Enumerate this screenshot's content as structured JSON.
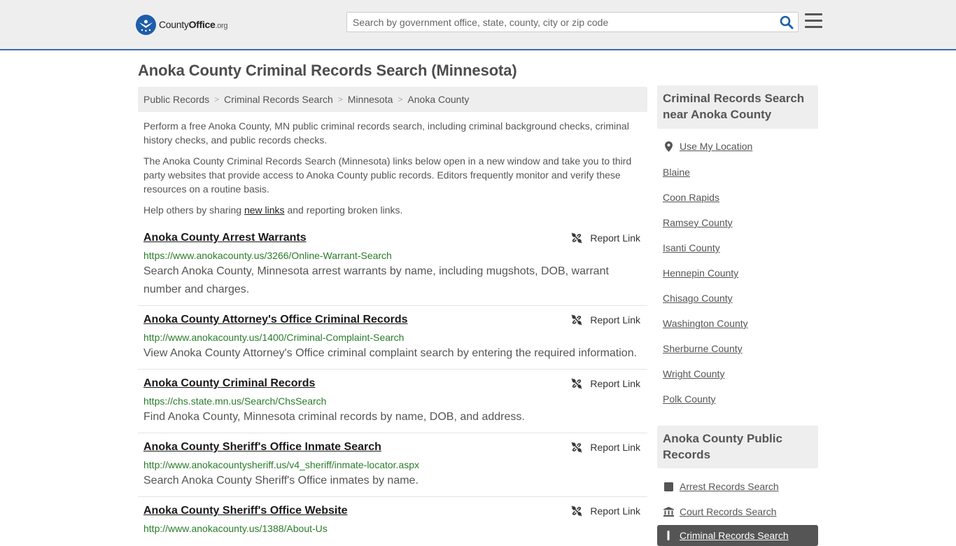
{
  "header": {
    "logo_county": "County",
    "logo_office": "Office",
    "logo_org": ".org",
    "search_placeholder": "Search by government office, state, county, city or zip code"
  },
  "page_title": "Anoka County Criminal Records Search (Minnesota)",
  "breadcrumb": [
    "Public Records",
    "Criminal Records Search",
    "Minnesota",
    "Anoka County"
  ],
  "intro": {
    "p1": "Perform a free Anoka County, MN public criminal records search, including criminal background checks, criminal history checks, and public records checks.",
    "p2": "The Anoka County Criminal Records Search (Minnesota) links below open in a new window and take you to third party websites that provide access to Anoka County public records. Editors frequently monitor and verify these resources on a routine basis.",
    "p3_before": "Help others by sharing ",
    "p3_link": "new links",
    "p3_after": " and reporting broken links."
  },
  "report_label": "Report Link",
  "results": [
    {
      "title": "Anoka County Arrest Warrants",
      "url": "https://www.anokacounty.us/3266/Online-Warrant-Search",
      "desc": "Search Anoka County, Minnesota arrest warrants by name, including mugshots, DOB, warrant number and charges."
    },
    {
      "title": "Anoka County Attorney's Office Criminal Records",
      "url": "http://www.anokacounty.us/1400/Criminal-Complaint-Search",
      "desc": "View Anoka County Attorney's Office criminal complaint search by entering the required information."
    },
    {
      "title": "Anoka County Criminal Records",
      "url": "https://chs.state.mn.us/Search/ChsSearch",
      "desc": "Find Anoka County, Minnesota criminal records by name, DOB, and address."
    },
    {
      "title": "Anoka County Sheriff's Office Inmate Search",
      "url": "http://www.anokacountysheriff.us/v4_sheriff/inmate-locator.aspx",
      "desc": "Search Anoka County Sheriff's Office inmates by name."
    },
    {
      "title": "Anoka County Sheriff's Office Website",
      "url": "http://www.anokacounty.us/1388/About-Us",
      "desc": ""
    }
  ],
  "sidebar": {
    "nearby_heading": "Criminal Records Search near Anoka County",
    "use_location": "Use My Location",
    "nearby": [
      "Blaine",
      "Coon Rapids",
      "Ramsey County",
      "Isanti County",
      "Hennepin County",
      "Chisago County",
      "Washington County",
      "Sherburne County",
      "Wright County",
      "Polk County"
    ],
    "public_heading": "Anoka County Public Records",
    "public_links": [
      "Arrest Records Search",
      "Court Records Search",
      "Criminal Records Search"
    ]
  },
  "colors": {
    "header_bg": "#eeeeee",
    "accent_blue": "#3a6cae",
    "url_green": "#2a7c2a",
    "active_bg": "#555555"
  }
}
